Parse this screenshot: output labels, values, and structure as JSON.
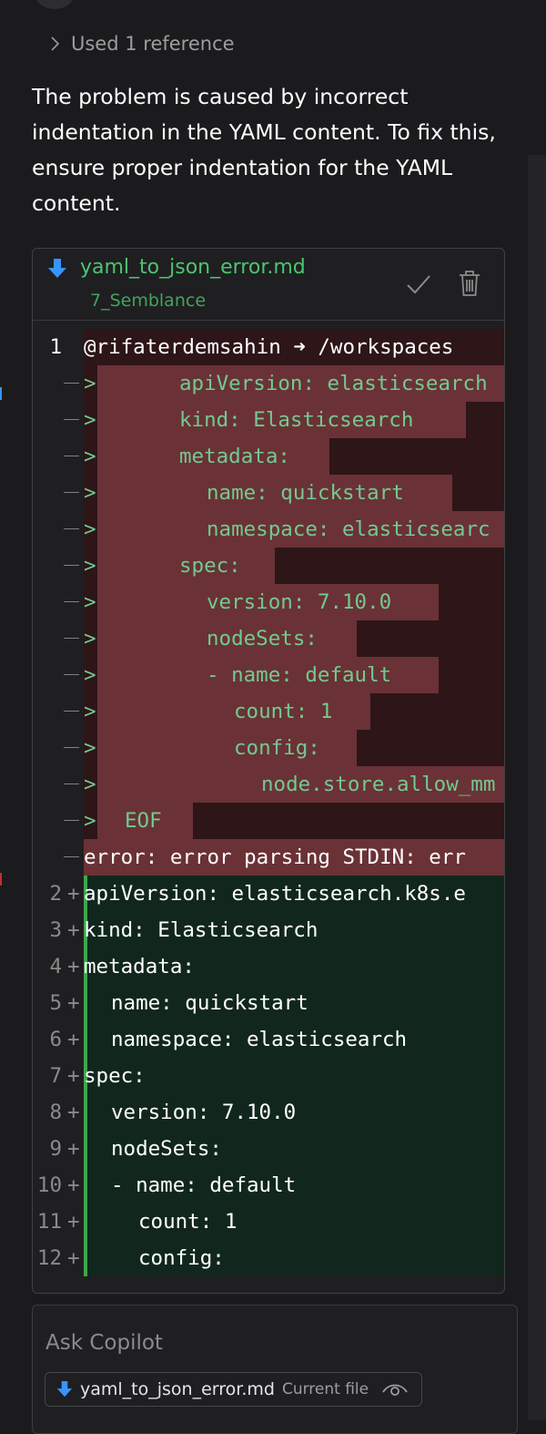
{
  "references": {
    "label": "Used 1 reference"
  },
  "answer": {
    "text": "The problem is caused by incorrect indentation in the YAML content. To fix this, ensure proper indentation for the YAML content."
  },
  "code_block": {
    "file_name": "yaml_to_json_error.md",
    "workspace": "7_Semblance",
    "removed": [
      {
        "gutter": "1",
        "marker": "",
        "indent": 0,
        "text": "@rifaterdemsahin ➜ /workspaces"
      },
      {
        "gutter": "",
        "marker": ">",
        "indent": 6,
        "text": "apiVersion: elasticsearch"
      },
      {
        "gutter": "",
        "marker": ">",
        "indent": 6,
        "text": "kind: Elasticsearch"
      },
      {
        "gutter": "",
        "marker": ">",
        "indent": 6,
        "text": "metadata:"
      },
      {
        "gutter": "",
        "marker": ">",
        "indent": 8,
        "text": "name: quickstart"
      },
      {
        "gutter": "",
        "marker": ">",
        "indent": 8,
        "text": "namespace: elasticsearc"
      },
      {
        "gutter": "",
        "marker": ">",
        "indent": 6,
        "text": "spec:"
      },
      {
        "gutter": "",
        "marker": ">",
        "indent": 8,
        "text": "version: 7.10.0"
      },
      {
        "gutter": "",
        "marker": ">",
        "indent": 8,
        "text": "nodeSets:"
      },
      {
        "gutter": "",
        "marker": ">",
        "indent": 8,
        "text": "- name: default"
      },
      {
        "gutter": "",
        "marker": ">",
        "indent": 10,
        "text": "count: 1"
      },
      {
        "gutter": "",
        "marker": ">",
        "indent": 10,
        "text": "config:"
      },
      {
        "gutter": "",
        "marker": ">",
        "indent": 12,
        "text": "node.store.allow_mm"
      },
      {
        "gutter": "",
        "marker": ">",
        "indent": 2,
        "text": "EOF"
      },
      {
        "gutter": "",
        "marker": "",
        "indent": 0,
        "text": "error: error parsing STDIN: err"
      }
    ],
    "added": [
      {
        "gutter": "2",
        "indent": 0,
        "text": "apiVersion: elasticsearch.k8s.e"
      },
      {
        "gutter": "3",
        "indent": 0,
        "text": "kind: Elasticsearch"
      },
      {
        "gutter": "4",
        "indent": 0,
        "text": "metadata:"
      },
      {
        "gutter": "5",
        "indent": 2,
        "text": "name: quickstart"
      },
      {
        "gutter": "6",
        "indent": 2,
        "text": "namespace: elasticsearch"
      },
      {
        "gutter": "7",
        "indent": 0,
        "text": "spec:"
      },
      {
        "gutter": "8",
        "indent": 2,
        "text": "version: 7.10.0"
      },
      {
        "gutter": "9",
        "indent": 2,
        "text": "nodeSets:"
      },
      {
        "gutter": "10",
        "indent": 2,
        "text": "- name: default"
      },
      {
        "gutter": "11",
        "indent": 4,
        "text": "count: 1"
      },
      {
        "gutter": "12",
        "indent": 4,
        "text": "config:"
      }
    ]
  },
  "ask": {
    "placeholder": "Ask Copilot",
    "attachment": {
      "name": "yaml_to_json_error.md",
      "label": "Current file"
    }
  },
  "colors": {
    "added_text": "#73c991",
    "removed_background": "#6a3236",
    "added_background": "#11271d",
    "file_name": "#4ec46f"
  },
  "icons": [
    "chevron-right-icon",
    "file-download-icon",
    "check-icon",
    "trash-icon",
    "eye-icon"
  ]
}
